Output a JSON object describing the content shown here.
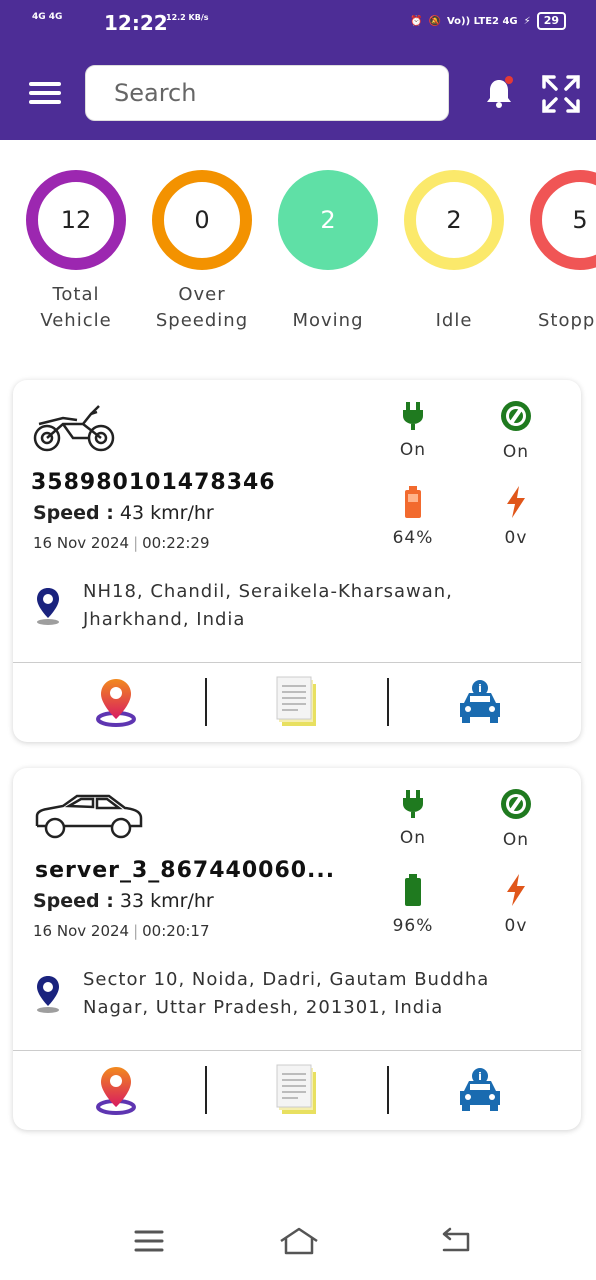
{
  "status_bar": {
    "network_left": "4G 4G",
    "time": "12:22",
    "speed": "12.2 KB/s",
    "network_right": "Vo)) LTE2 4G",
    "battery": "29"
  },
  "search": {
    "placeholder": "Search"
  },
  "stats": [
    {
      "value": "12",
      "label": "Total Vehicle",
      "color": "#9c27b0"
    },
    {
      "value": "0",
      "label": "Over Speeding",
      "color": "#f39200"
    },
    {
      "value": "2",
      "label": "Moving",
      "color": "#5fe0a6"
    },
    {
      "value": "2",
      "label": "Idle",
      "color": "#fbe96b"
    },
    {
      "value": "5",
      "label": "Stopp",
      "color": "#f05555"
    }
  ],
  "vehicles": [
    {
      "type": "motorcycle",
      "id": "358980101478346",
      "speed_label": "Speed :",
      "speed": "43 kmr/hr",
      "date": "16 Nov 2024",
      "time": "00:22:29",
      "power": "On",
      "ignition": "On",
      "battery": "64%",
      "voltage": "0v",
      "address": "NH18, Chandil, Seraikela-Kharsawan, Jharkhand, India"
    },
    {
      "type": "car",
      "id": "server_3_867440060...",
      "speed_label": "Speed :",
      "speed": "33 kmr/hr",
      "date": "16 Nov 2024",
      "time": "00:20:17",
      "power": "On",
      "ignition": "On",
      "battery": "96%",
      "voltage": "0v",
      "address": "Sector 10, Noida, Dadri, Gautam Buddha Nagar, Uttar Pradesh, 201301, India"
    }
  ],
  "colors": {
    "header": "#4d2d96",
    "power_green": "#1f7a1f",
    "battery_orange": "#f26a2e",
    "battery_green": "#1f7a1f",
    "voltage_orange": "#e0561a",
    "car_blue": "#1a6bb0"
  }
}
